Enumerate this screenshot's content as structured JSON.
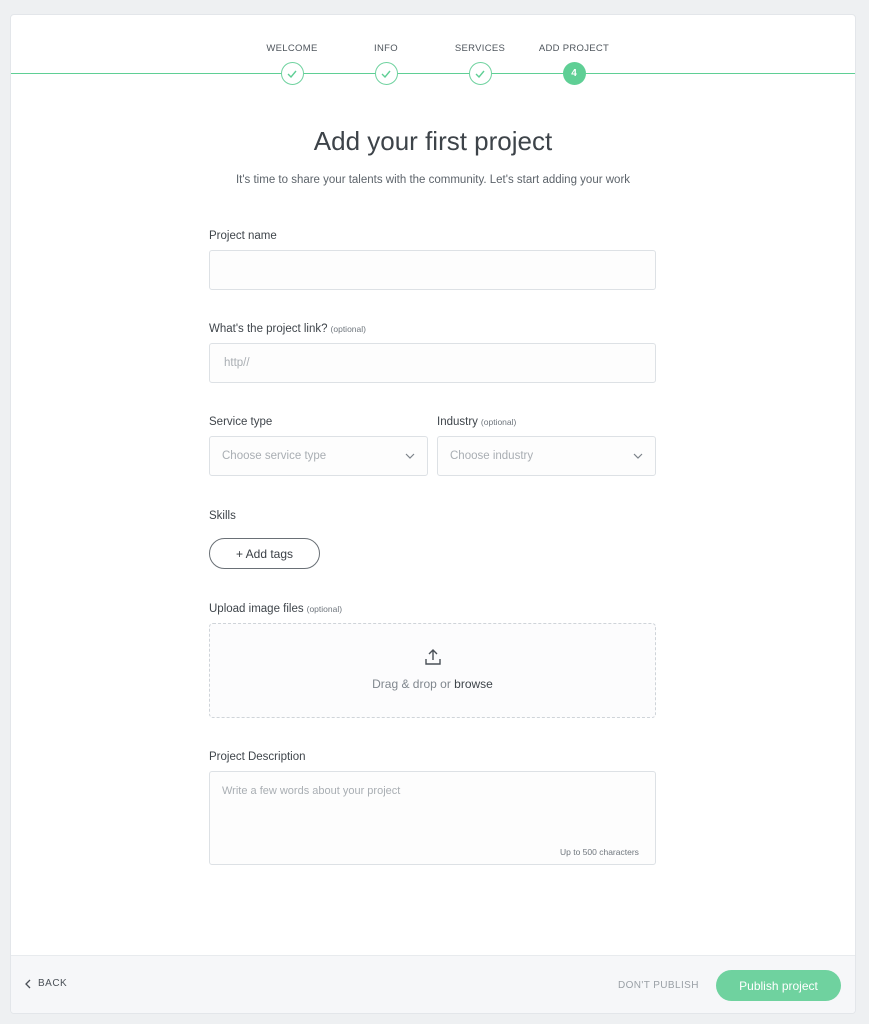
{
  "stepper": {
    "steps": [
      {
        "label": "WELCOME",
        "state": "done"
      },
      {
        "label": "INFO",
        "state": "done"
      },
      {
        "label": "SERVICES",
        "state": "done"
      },
      {
        "label": "ADD PROJECT",
        "state": "active",
        "number": "4"
      }
    ]
  },
  "header": {
    "title": "Add your first project",
    "subtitle": "It's time to share your talents with the community. Let's start adding your work"
  },
  "form": {
    "project_name": {
      "label": "Project name",
      "value": "",
      "placeholder": ""
    },
    "project_link": {
      "label": "What's the project link?",
      "optional": "(optional)",
      "value": "",
      "placeholder": "http//"
    },
    "service_type": {
      "label": "Service type",
      "placeholder": "Choose service type"
    },
    "industry": {
      "label": "Industry",
      "optional": "(optional)",
      "placeholder": "Choose industry"
    },
    "skills": {
      "label": "Skills",
      "add_tags_label": "+ Add tags"
    },
    "upload": {
      "label": "Upload image files",
      "optional": "(optional)",
      "drop_text": "Drag & drop or",
      "browse_text": "browse"
    },
    "description": {
      "label": "Project Description",
      "placeholder": "Write a few words about your project",
      "limit_text": "Up to 500 characters"
    }
  },
  "footer": {
    "back_label": "BACK",
    "dont_publish_label": "DON'T PUBLISH",
    "publish_label": "Publish project"
  },
  "colors": {
    "accent": "#5fcf95",
    "background": "#eef0f2"
  },
  "icons": {
    "check": "check-icon",
    "chevron": "chevron-down-icon",
    "upload": "upload-icon",
    "back": "chevron-left-icon"
  }
}
